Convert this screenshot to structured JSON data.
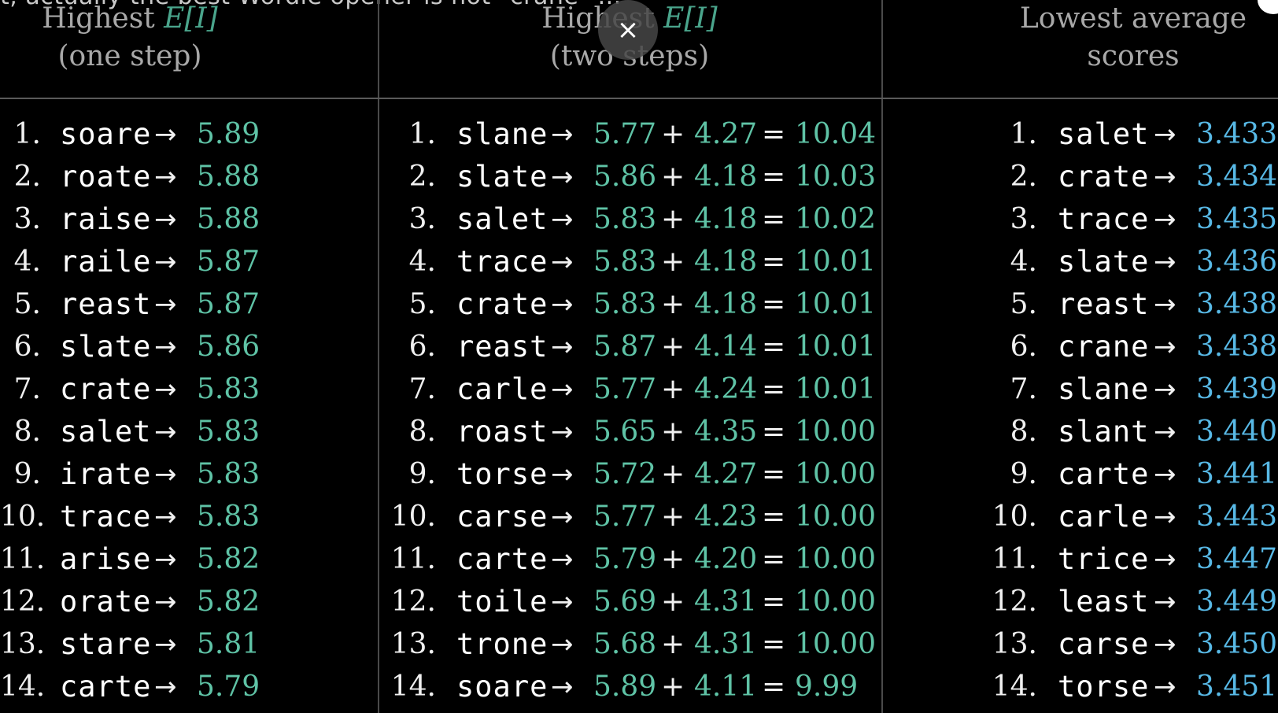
{
  "caption_partial": "t, actually the best Wordle opener is not \"crane\" ...",
  "close_icon_glyph": "×",
  "columns": [
    {
      "header_line1_prefix": "Highest ",
      "header_line1_em": "E[I]",
      "header_line2": "(one step)",
      "rows": [
        {
          "rank": "1.",
          "word": "soare",
          "arrow": "→",
          "value": "5.89"
        },
        {
          "rank": "2.",
          "word": "roate",
          "arrow": "→",
          "value": "5.88"
        },
        {
          "rank": "3.",
          "word": "raise",
          "arrow": "→",
          "value": "5.88"
        },
        {
          "rank": "4.",
          "word": "raile",
          "arrow": "→",
          "value": "5.87"
        },
        {
          "rank": "5.",
          "word": "reast",
          "arrow": "→",
          "value": "5.87"
        },
        {
          "rank": "6.",
          "word": "slate",
          "arrow": "→",
          "value": "5.86"
        },
        {
          "rank": "7.",
          "word": "crate",
          "arrow": "→",
          "value": "5.83"
        },
        {
          "rank": "8.",
          "word": "salet",
          "arrow": "→",
          "value": "5.83"
        },
        {
          "rank": "9.",
          "word": "irate",
          "arrow": "→",
          "value": "5.83"
        },
        {
          "rank": "10.",
          "word": "trace",
          "arrow": "→",
          "value": "5.83"
        },
        {
          "rank": "11.",
          "word": "arise",
          "arrow": "→",
          "value": "5.82"
        },
        {
          "rank": "12.",
          "word": "orate",
          "arrow": "→",
          "value": "5.82"
        },
        {
          "rank": "13.",
          "word": "stare",
          "arrow": "→",
          "value": "5.81"
        },
        {
          "rank": "14.",
          "word": "carte",
          "arrow": "→",
          "value": "5.79"
        }
      ]
    },
    {
      "header_line1_prefix": "Highest ",
      "header_line1_em": "E[I]",
      "header_line2": "(two steps)",
      "rows": [
        {
          "rank": "1.",
          "word": "slane",
          "arrow": "→",
          "a": "5.77",
          "plus": "+",
          "b": "4.27",
          "eq": "=",
          "total": "10.04"
        },
        {
          "rank": "2.",
          "word": "slate",
          "arrow": "→",
          "a": "5.86",
          "plus": "+",
          "b": "4.18",
          "eq": "=",
          "total": "10.03"
        },
        {
          "rank": "3.",
          "word": "salet",
          "arrow": "→",
          "a": "5.83",
          "plus": "+",
          "b": "4.18",
          "eq": "=",
          "total": "10.02"
        },
        {
          "rank": "4.",
          "word": "trace",
          "arrow": "→",
          "a": "5.83",
          "plus": "+",
          "b": "4.18",
          "eq": "=",
          "total": "10.01"
        },
        {
          "rank": "5.",
          "word": "crate",
          "arrow": "→",
          "a": "5.83",
          "plus": "+",
          "b": "4.18",
          "eq": "=",
          "total": "10.01"
        },
        {
          "rank": "6.",
          "word": "reast",
          "arrow": "→",
          "a": "5.87",
          "plus": "+",
          "b": "4.14",
          "eq": "=",
          "total": "10.01"
        },
        {
          "rank": "7.",
          "word": "carle",
          "arrow": "→",
          "a": "5.77",
          "plus": "+",
          "b": "4.24",
          "eq": "=",
          "total": "10.01"
        },
        {
          "rank": "8.",
          "word": "roast",
          "arrow": "→",
          "a": "5.65",
          "plus": "+",
          "b": "4.35",
          "eq": "=",
          "total": "10.00"
        },
        {
          "rank": "9.",
          "word": "torse",
          "arrow": "→",
          "a": "5.72",
          "plus": "+",
          "b": "4.27",
          "eq": "=",
          "total": "10.00"
        },
        {
          "rank": "10.",
          "word": "carse",
          "arrow": "→",
          "a": "5.77",
          "plus": "+",
          "b": "4.23",
          "eq": "=",
          "total": "10.00"
        },
        {
          "rank": "11.",
          "word": "carte",
          "arrow": "→",
          "a": "5.79",
          "plus": "+",
          "b": "4.20",
          "eq": "=",
          "total": "10.00"
        },
        {
          "rank": "12.",
          "word": "toile",
          "arrow": "→",
          "a": "5.69",
          "plus": "+",
          "b": "4.31",
          "eq": "=",
          "total": "10.00"
        },
        {
          "rank": "13.",
          "word": "trone",
          "arrow": "→",
          "a": "5.68",
          "plus": "+",
          "b": "4.31",
          "eq": "=",
          "total": "10.00"
        },
        {
          "rank": "14.",
          "word": "soare",
          "arrow": "→",
          "a": "5.89",
          "plus": "+",
          "b": "4.11",
          "eq": "=",
          "total": "9.99"
        }
      ]
    },
    {
      "header_line1": "Lowest average",
      "header_line2": "scores",
      "rows": [
        {
          "rank": "1.",
          "word": "salet",
          "arrow": "→",
          "value": "3.433"
        },
        {
          "rank": "2.",
          "word": "crate",
          "arrow": "→",
          "value": "3.434"
        },
        {
          "rank": "3.",
          "word": "trace",
          "arrow": "→",
          "value": "3.435"
        },
        {
          "rank": "4.",
          "word": "slate",
          "arrow": "→",
          "value": "3.436"
        },
        {
          "rank": "5.",
          "word": "reast",
          "arrow": "→",
          "value": "3.438"
        },
        {
          "rank": "6.",
          "word": "crane",
          "arrow": "→",
          "value": "3.438"
        },
        {
          "rank": "7.",
          "word": "slane",
          "arrow": "→",
          "value": "3.439"
        },
        {
          "rank": "8.",
          "word": "slant",
          "arrow": "→",
          "value": "3.440"
        },
        {
          "rank": "9.",
          "word": "carte",
          "arrow": "→",
          "value": "3.441"
        },
        {
          "rank": "10.",
          "word": "carle",
          "arrow": "→",
          "value": "3.443"
        },
        {
          "rank": "11.",
          "word": "trice",
          "arrow": "→",
          "value": "3.447"
        },
        {
          "rank": "12.",
          "word": "least",
          "arrow": "→",
          "value": "3.449"
        },
        {
          "rank": "13.",
          "word": "carse",
          "arrow": "→",
          "value": "3.450"
        },
        {
          "rank": "14.",
          "word": "torse",
          "arrow": "→",
          "value": "3.451"
        }
      ]
    }
  ],
  "colors": {
    "background": "#000000",
    "green_value": "#5fc3a6",
    "blue_value": "#58b9e6",
    "header_em": "#4aa58c"
  }
}
